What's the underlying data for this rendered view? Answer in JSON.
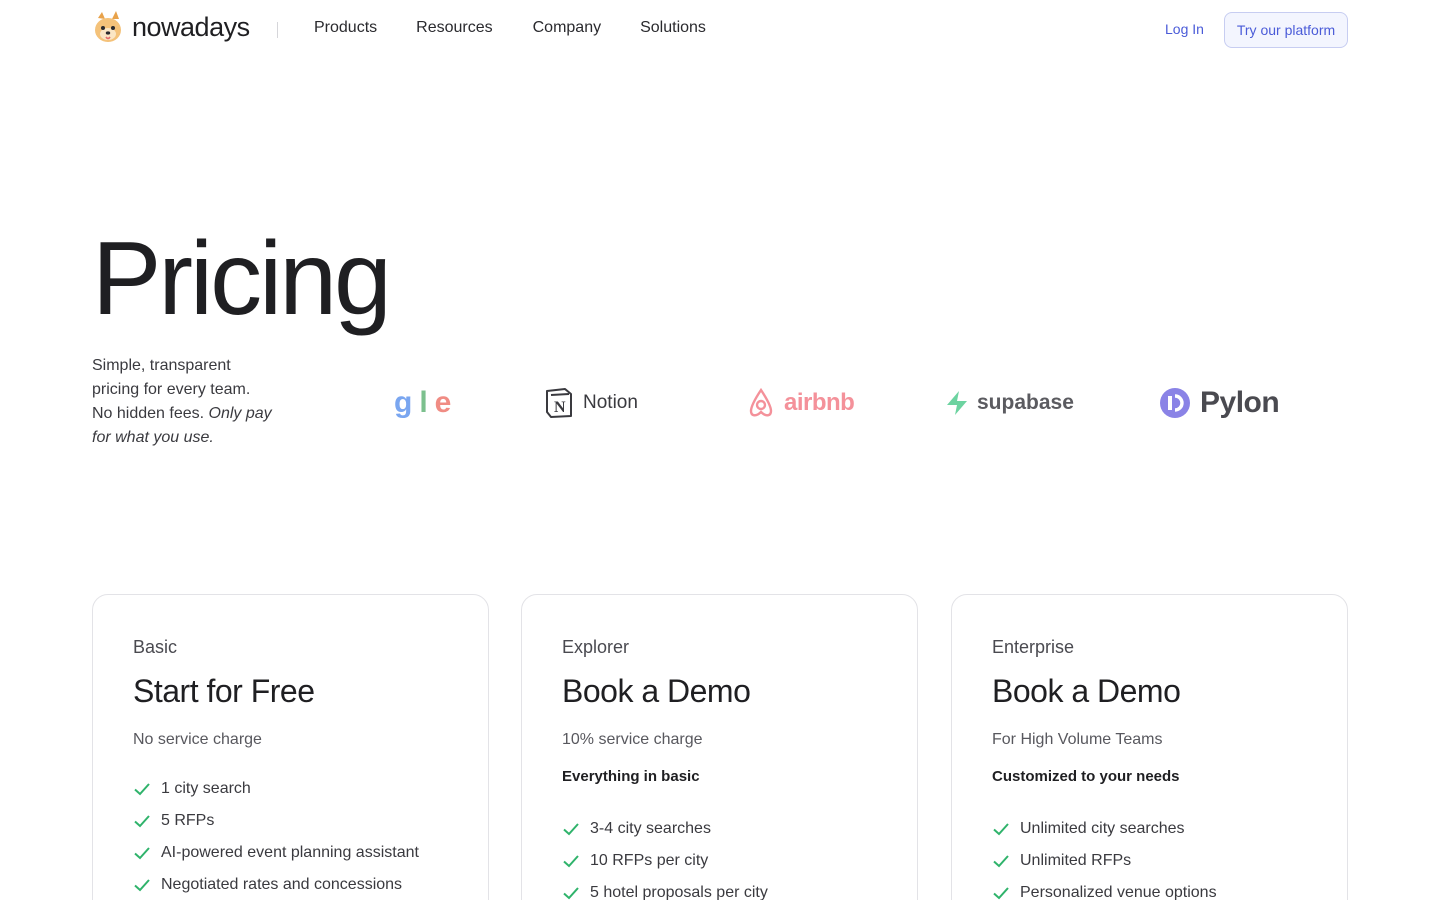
{
  "nav": {
    "brand": "nowadays",
    "links": [
      "Products",
      "Resources",
      "Company",
      "Solutions"
    ],
    "login": "Log In",
    "cta": "Try our platform"
  },
  "hero": {
    "title": "Pricing",
    "subtitle_plain": "Simple, transparent pricing for every team. No hidden fees.",
    "subtitle_em": "Only pay for what you use."
  },
  "logos": {
    "google_fragment": [
      "g",
      "l",
      "e"
    ],
    "notion": "Notion",
    "airbnb": "airbnb",
    "supabase": "supabase",
    "pylon": "Pylon"
  },
  "colors": {
    "accent": "#4a5bd8",
    "check": "#2fb36b"
  },
  "plans": [
    {
      "tier": "Basic",
      "title": "Start for Free",
      "sub": "No service charge",
      "includes": "",
      "features": [
        "1 city search",
        "5 RFPs",
        "AI-powered event planning assistant",
        "Negotiated rates and concessions"
      ]
    },
    {
      "tier": "Explorer",
      "title": "Book a Demo",
      "sub": "10% service charge",
      "includes": "Everything in basic",
      "features": [
        "3-4 city searches",
        "10 RFPs per city",
        "5 hotel proposals per city"
      ]
    },
    {
      "tier": "Enterprise",
      "title": "Book a Demo",
      "sub": "For High Volume Teams",
      "includes": "Customized to your needs",
      "features": [
        "Unlimited city searches",
        "Unlimited RFPs",
        "Personalized venue options"
      ]
    }
  ]
}
